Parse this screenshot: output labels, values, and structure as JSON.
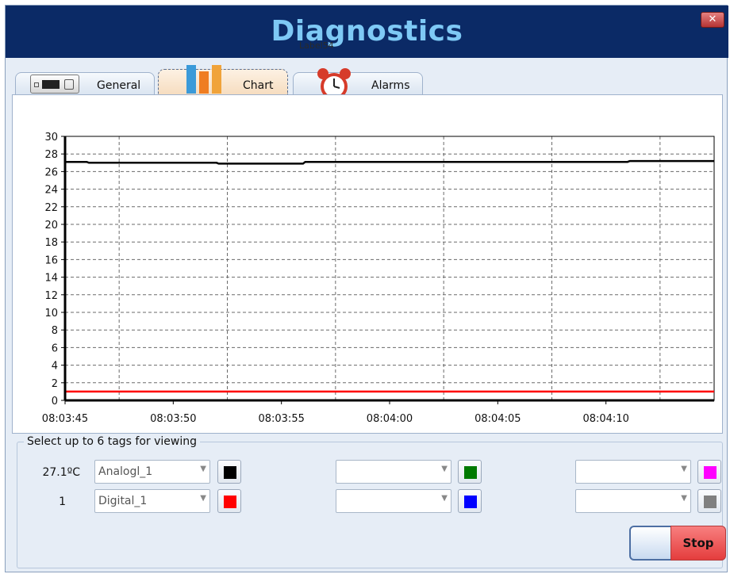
{
  "window": {
    "title": "Diagnostics",
    "overlay_label": "Label54",
    "close_glyph": "✕"
  },
  "tabs": [
    {
      "label": "General",
      "icon": "device-icon",
      "active": false
    },
    {
      "label": "Chart",
      "icon": "bar-chart-icon",
      "active": true
    },
    {
      "label": "Alarms",
      "icon": "alarm-clock-icon",
      "active": false
    }
  ],
  "chart_data": {
    "type": "line",
    "ylim": [
      0,
      30
    ],
    "yticks": [
      0,
      2,
      4,
      6,
      8,
      10,
      12,
      14,
      16,
      18,
      20,
      22,
      24,
      26,
      28,
      30
    ],
    "xlim": [
      0,
      30
    ],
    "x_tick_positions": [
      0,
      5,
      10,
      15,
      20,
      25
    ],
    "x_tick_labels": [
      "08:03:45",
      "08:03:50",
      "08:03:55",
      "08:04:00",
      "08:04:05",
      "08:04:10"
    ],
    "grid": true,
    "series": [
      {
        "color": "#000000",
        "x": [
          0,
          1,
          1.1,
          7,
          7.1,
          11,
          11.1,
          26,
          26.1,
          30
        ],
        "y": [
          27.1,
          27.1,
          27.0,
          27.0,
          26.9,
          26.9,
          27.1,
          27.1,
          27.2,
          27.2
        ]
      },
      {
        "color": "#ff0000",
        "x": [
          0,
          30
        ],
        "y": [
          1,
          1
        ]
      }
    ]
  },
  "tags": {
    "legend": "Select up to 6 tags for viewing",
    "rows": [
      [
        {
          "value": "27.1ºC",
          "tag": "Analogl_1",
          "color": "#000000"
        },
        {
          "value": "",
          "tag": "",
          "color": "#007a00"
        },
        {
          "value": "",
          "tag": "",
          "color": "#ff00ff"
        }
      ],
      [
        {
          "value": "1",
          "tag": "Digital_1",
          "color": "#ff0000"
        },
        {
          "value": "",
          "tag": "",
          "color": "#0000ff"
        },
        {
          "value": "",
          "tag": "",
          "color": "#808080"
        }
      ]
    ],
    "combo_arrow": "▼"
  },
  "controls": {
    "stop_label": "Stop"
  }
}
